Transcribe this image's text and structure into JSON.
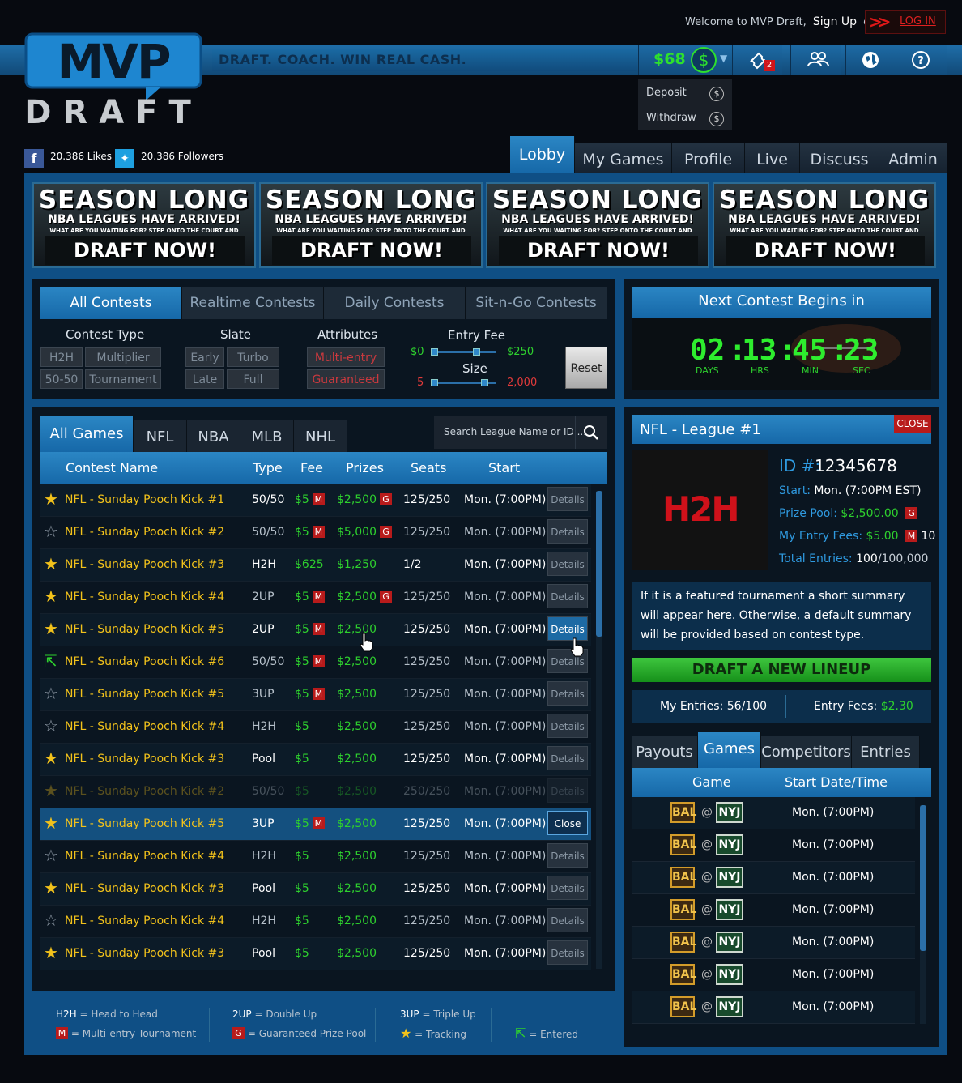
{
  "header": {
    "tagline": "DRAFT. COACH. WIN REAL CASH.",
    "welcome": "Welcome to MVP Draft,",
    "signup": "Sign Up",
    "or": "or",
    "login": "LOG IN",
    "balance": "$68",
    "notifications": "2",
    "logo_top": "MVP",
    "logo_bottom": "DRAFT"
  },
  "wallet_menu": {
    "deposit": "Deposit",
    "withdraw": "Withdraw"
  },
  "social": {
    "likes": "20.386 Likes",
    "followers": "20.386 Followers"
  },
  "nav": [
    "Lobby",
    "My Games",
    "Profile",
    "Live",
    "Discuss",
    "Admin"
  ],
  "banner": {
    "line1": "SEASON LONG",
    "line2": "NBA LEAGUES HAVE ARRIVED!",
    "line3": "WHAT ARE YOU WAITING FOR? STEP ONTO THE COURT AND",
    "line4": "DRAFT NOW!"
  },
  "contest_tabs": [
    "All Contests",
    "Realtime Contests",
    "Daily Contests",
    "Sit-n-Go Contests"
  ],
  "filters": {
    "contest_type_label": "Contest Type",
    "contest_type": [
      "H2H",
      "Multiplier",
      "50-50",
      "Tournament"
    ],
    "slate_label": "Slate",
    "slate": [
      "Early",
      "Turbo",
      "Late",
      "Full"
    ],
    "attributes_label": "Attributes",
    "attributes": [
      "Multi-entry",
      "Guaranteed"
    ],
    "entry_fee_label": "Entry Fee",
    "fee_min": "$0",
    "fee_max": "$250",
    "size_label": "Size",
    "size_min": "5",
    "size_max": "2,000",
    "reset": "Reset"
  },
  "countdown": {
    "title": "Next Contest Begins in",
    "days": "02",
    "hrs": "13",
    "min": "45",
    "sec": "23",
    "days_label": "DAYS",
    "hrs_label": "HRS",
    "min_label": "MIN",
    "sec_label": "SEC"
  },
  "game_tabs": [
    "All Games",
    "NFL",
    "NBA",
    "MLB",
    "NHL"
  ],
  "search_placeholder": "Search League Name or ID ...",
  "table_headers": [
    "Contest Name",
    "Type",
    "Fee",
    "Prizes",
    "Seats",
    "Start"
  ],
  "rows": [
    {
      "name": "NFL - Sunday Pooch Kick #1",
      "type": "50/50",
      "fee": "$5",
      "m": "M",
      "prize": "$2,500",
      "g": "G",
      "seats": "125/250",
      "start": "Mon. (7:00PM)",
      "btn": "Details",
      "icon": "star"
    },
    {
      "name": "NFL - Sunday Pooch Kick #2",
      "type": "50/50",
      "fee": "$5",
      "m": "M",
      "prize": "$5,000",
      "g": "G",
      "seats": "125/250",
      "start": "Mon. (7:00PM)",
      "btn": "Details",
      "icon": "star-empty"
    },
    {
      "name": "NFL - Sunday Pooch Kick #3",
      "type": "H2H",
      "fee": "$625",
      "m": "",
      "prize": "$1,250",
      "g": "",
      "seats": "1/2",
      "start": "Mon. (7:00PM)",
      "btn": "Details",
      "icon": "star"
    },
    {
      "name": "NFL - Sunday Pooch Kick #4",
      "type": "2UP",
      "fee": "$5",
      "m": "M",
      "prize": "$2,500",
      "g": "G",
      "seats": "125/250",
      "start": "Mon. (7:00PM)",
      "btn": "Details",
      "icon": "star"
    },
    {
      "name": "NFL - Sunday Pooch Kick #5",
      "type": "2UP",
      "fee": "$5",
      "m": "M",
      "prize": "$2,500",
      "g": "",
      "seats": "125/250",
      "start": "Mon. (7:00PM)",
      "btn": "Details",
      "icon": "star"
    },
    {
      "name": "NFL - Sunday Pooch Kick #6",
      "type": "50/50",
      "fee": "$5",
      "m": "M",
      "prize": "$2,500",
      "g": "",
      "seats": "125/250",
      "start": "Mon. (7:00PM)",
      "btn": "Details",
      "icon": "entered"
    },
    {
      "name": "NFL - Sunday Pooch Kick #5",
      "type": "3UP",
      "fee": "$5",
      "m": "M",
      "prize": "$2,500",
      "g": "",
      "seats": "125/250",
      "start": "Mon. (7:00PM)",
      "btn": "Details",
      "icon": "star-empty"
    },
    {
      "name": "NFL - Sunday Pooch Kick #4",
      "type": "H2H",
      "fee": "$5",
      "m": "",
      "prize": "$2,500",
      "g": "",
      "seats": "125/250",
      "start": "Mon. (7:00PM)",
      "btn": "Details",
      "icon": "star-empty"
    },
    {
      "name": "NFL - Sunday Pooch Kick #3",
      "type": "Pool",
      "fee": "$5",
      "m": "",
      "prize": "$2,500",
      "g": "",
      "seats": "125/250",
      "start": "Mon. (7:00PM)",
      "btn": "Details",
      "icon": "star"
    },
    {
      "name": "NFL - Sunday Pooch Kick #2",
      "type": "50/50",
      "fee": "$5",
      "m": "",
      "prize": "$2,500",
      "g": "",
      "seats": "250/250",
      "start": "Mon. (7:00PM)",
      "btn": "Details",
      "icon": "star-dim"
    },
    {
      "name": "NFL - Sunday Pooch Kick #5",
      "type": "3UP",
      "fee": "$5",
      "m": "M",
      "prize": "$2,500",
      "g": "",
      "seats": "125/250",
      "start": "Mon. (7:00PM)",
      "btn": "Close",
      "icon": "star"
    },
    {
      "name": "NFL - Sunday Pooch Kick #4",
      "type": "H2H",
      "fee": "$5",
      "m": "",
      "prize": "$2,500",
      "g": "",
      "seats": "125/250",
      "start": "Mon. (7:00PM)",
      "btn": "Details",
      "icon": "star-empty"
    },
    {
      "name": "NFL - Sunday Pooch Kick #3",
      "type": "Pool",
      "fee": "$5",
      "m": "",
      "prize": "$2,500",
      "g": "",
      "seats": "125/250",
      "start": "Mon. (7:00PM)",
      "btn": "Details",
      "icon": "star"
    },
    {
      "name": "NFL - Sunday Pooch Kick #4",
      "type": "H2H",
      "fee": "$5",
      "m": "",
      "prize": "$2,500",
      "g": "",
      "seats": "125/250",
      "start": "Mon. (7:00PM)",
      "btn": "Details",
      "icon": "star-empty"
    },
    {
      "name": "NFL - Sunday Pooch Kick #3",
      "type": "Pool",
      "fee": "$5",
      "m": "",
      "prize": "$2,500",
      "g": "",
      "seats": "125/250",
      "start": "Mon. (7:00PM)",
      "btn": "Details",
      "icon": "star"
    }
  ],
  "legend": {
    "h2h_key": "H2H",
    "h2h": "= Head to Head",
    "m_key": "M",
    "m": "= Multi-entry Tournament",
    "up2_key": "2UP",
    "up2": "= Double Up",
    "g_key": "G",
    "g": "= Guaranteed Prize Pool",
    "up3_key": "3UP",
    "up3": "= Triple Up",
    "tracking": "= Tracking",
    "entered": "= Entered"
  },
  "league": {
    "title": "NFL - League #1",
    "close": "CLOSE",
    "badge": "H2H",
    "id_label": "ID #:",
    "id": "12345678",
    "start_label": "Start:",
    "start": "Mon. (7:00PM EST)",
    "prize_label": "Prize Pool:",
    "prize": "$2,500.00",
    "prize_badge": "G",
    "fees_label": "My Entry Fees:",
    "fees": "$5.00",
    "fees_badge": "M",
    "fees_count": "10",
    "total_label": "Total Entries:",
    "total": "100",
    "total_max": "/100,000",
    "summary": "If it is a featured tournament a short summary will appear here. Otherwise, a default summary will be provided based on contest type.",
    "draft_btn": "DRAFT A NEW LINEUP",
    "my_entries_label": "My Entries:",
    "my_entries": "56/100",
    "entry_fees_label": "Entry Fees:",
    "entry_fees": "$2.30"
  },
  "detail_tabs": [
    "Payouts",
    "Games",
    "Competitors",
    "Entries"
  ],
  "games_headers": [
    "Game",
    "Start Date/Time"
  ],
  "games": [
    {
      "away": "BAL",
      "home": "NYJ",
      "time": "Mon. (7:00PM)"
    },
    {
      "away": "BAL",
      "home": "NYJ",
      "time": "Mon. (7:00PM)"
    },
    {
      "away": "BAL",
      "home": "NYJ",
      "time": "Mon. (7:00PM)"
    },
    {
      "away": "BAL",
      "home": "NYJ",
      "time": "Mon. (7:00PM)"
    },
    {
      "away": "BAL",
      "home": "NYJ",
      "time": "Mon. (7:00PM)"
    },
    {
      "away": "BAL",
      "home": "NYJ",
      "time": "Mon. (7:00PM)"
    },
    {
      "away": "BAL",
      "home": "NYJ",
      "time": "Mon. (7:00PM)"
    }
  ],
  "colors": {
    "accent": "#1b7ac0",
    "money": "#2ee02e",
    "badge": "#b81b1b",
    "star": "#f2c21b"
  }
}
